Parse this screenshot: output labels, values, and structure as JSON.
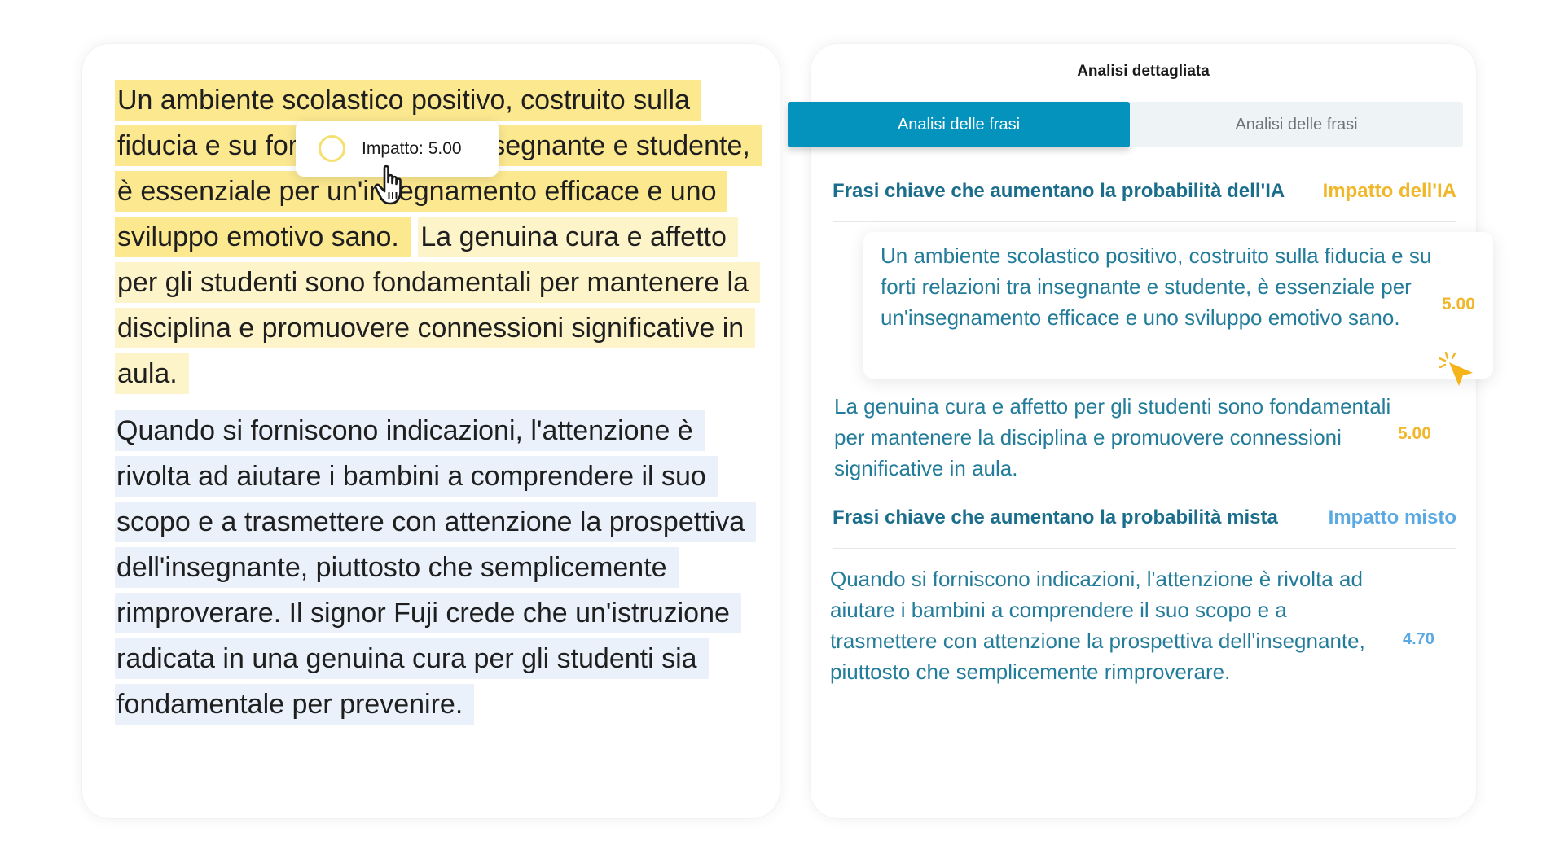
{
  "left": {
    "para1": {
      "strong": "Un ambiente scolastico positivo, costruito sulla fiducia e su forti relazioni tra insegnante e studente, è essenziale per un'insegnamento efficace e uno sviluppo emotivo sano.",
      "soft": "La genuina cura e affetto per gli studenti sono fondamentali per mantenere la disciplina e promuovere connessioni significative in aula."
    },
    "para2": "Quando si forniscono indicazioni, l'attenzione è rivolta ad aiutare i bambini a comprendere il suo scopo e a trasmettere con attenzione la prospettiva dell'insegnante, piuttosto che semplicemente rimproverare. Il signor Fuji crede che un'istruzione radicata in una genuina cura per gli studenti sia fondamentale per prevenire.",
    "tooltip": "Impatto: 5.00",
    "cursor_icon": "hand-pointer-icon"
  },
  "right": {
    "title": "Analisi dettagliata",
    "tabs": [
      {
        "label": "Analisi delle frasi",
        "active": true
      },
      {
        "label": "Analisi delle frasi",
        "active": false
      }
    ],
    "sections": [
      {
        "title": "Frasi chiave che aumentano la probabilità dell'IA",
        "impact_label": "Impatto dell'IA",
        "items": [
          {
            "text": "Un ambiente scolastico positivo, costruito sulla fiducia e su forti relazioni tra insegnante e studente, è essenziale per un'insegnamento efficace e uno sviluppo emotivo sano.",
            "score": "5.00"
          },
          {
            "text": "La genuina cura e affetto per gli studenti sono fondamentali per mantenere la disciplina e promuovere connessioni significative in aula.",
            "score": "5.00"
          }
        ]
      },
      {
        "title": "Frasi chiave che aumentano la probabilità mista",
        "impact_label": "Impatto misto",
        "items": [
          {
            "text": "Quando si forniscono indicazioni, l'attenzione è rivolta ad aiutare i bambini a comprendere il suo scopo e a trasmettere con attenzione la prospettiva dell'insegnante, piuttosto che semplicemente rimproverare.",
            "score": "4.70"
          }
        ]
      }
    ],
    "cursor_icon": "click-cursor-icon"
  },
  "colors": {
    "accent": "#0493bc",
    "ai_impact": "#f1b72a",
    "mixed_impact": "#5aa9e3",
    "highlight_strong": "#fbe88f",
    "highlight_soft": "#fdf4c9",
    "highlight_blue": "#eaf1fb"
  }
}
